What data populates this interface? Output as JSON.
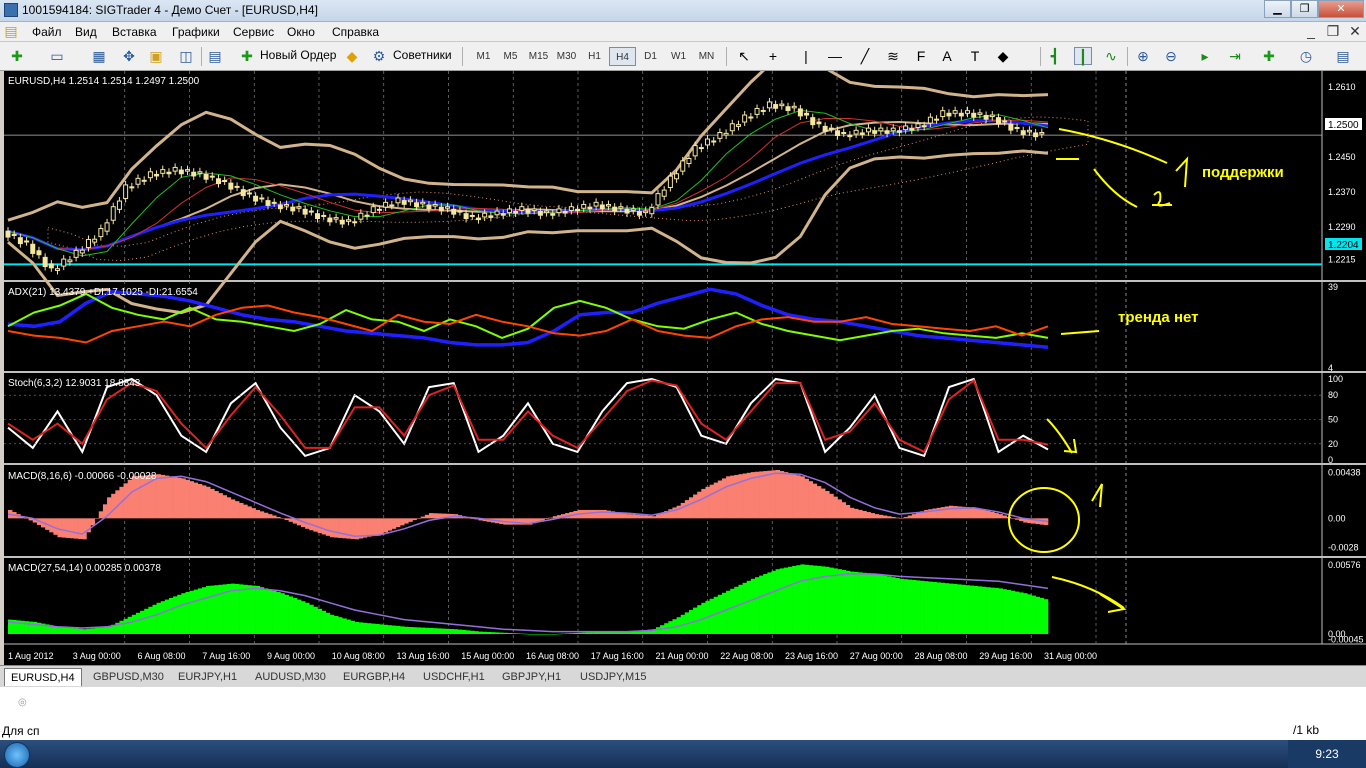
{
  "window": {
    "title": "1001594184: SIGTrader 4 - Демо Счет - [EURUSD,H4]"
  },
  "menu": [
    "Файл",
    "Вид",
    "Вставка",
    "Графики",
    "Сервис",
    "Окно",
    "Справка"
  ],
  "toolbar": {
    "new_order": "Новый Ордер",
    "advisors": "Советники",
    "timeframes": [
      "M1",
      "M5",
      "M15",
      "M30",
      "H1",
      "H4",
      "D1",
      "W1",
      "MN"
    ],
    "active_timeframe": "H4"
  },
  "chart_data": [
    {
      "type": "candlestick",
      "title": "EURUSD,H4  1.2514 1.2514 1.2497 1.2500",
      "yticks": [
        "1.2610",
        "1.2530",
        "1.2450",
        "1.2370",
        "1.2290",
        "1.2215"
      ],
      "ylim": [
        1.2175,
        1.264
      ],
      "current_price_label": "1.2500",
      "horizontal_level_label": "1.2204",
      "horizontal_level": 1.2204,
      "close_series": [
        1.228,
        1.225,
        1.219,
        1.223,
        1.228,
        1.238,
        1.241,
        1.242,
        1.241,
        1.239,
        1.236,
        1.234,
        1.233,
        1.231,
        1.23,
        1.233,
        1.235,
        1.234,
        1.233,
        1.231,
        1.232,
        1.233,
        1.232,
        1.233,
        1.234,
        1.233,
        1.232,
        1.24,
        1.247,
        1.25,
        1.254,
        1.257,
        1.256,
        1.252,
        1.25,
        1.251,
        1.251,
        1.252,
        1.255,
        1.255,
        1.254,
        1.251,
        1.25
      ],
      "annotations": [
        "поддержки"
      ],
      "colors": {
        "bollinger": "#d2b48c",
        "ma_blue": "#2020ff",
        "cyan_level": "#00e5ee",
        "annotation": "#ffff00"
      }
    },
    {
      "type": "line",
      "title": "ADX(21) 13.4379 +DI:17.1025 -DI:21.6554",
      "yticks": [
        "39",
        "4"
      ],
      "ylim": [
        4,
        39
      ],
      "series": [
        {
          "name": "ADX",
          "values": [
            23,
            22,
            24,
            32,
            37,
            36,
            35,
            33,
            30,
            27,
            25,
            24,
            22,
            20,
            19,
            18,
            17,
            15,
            14,
            14,
            15,
            20,
            27,
            28,
            28,
            32,
            35,
            38,
            36,
            31,
            27,
            25,
            24,
            22,
            20,
            18,
            17,
            16,
            15,
            14,
            13
          ]
        },
        {
          "name": "+DI",
          "values": [
            22,
            28,
            31,
            36,
            30,
            27,
            25,
            30,
            25,
            24,
            22,
            20,
            23,
            29,
            25,
            24,
            20,
            25,
            22,
            17,
            21,
            30,
            33,
            30,
            25,
            22,
            21,
            25,
            28,
            23,
            20,
            18,
            16,
            18,
            20,
            21,
            19,
            18,
            17,
            19,
            17
          ]
        },
        {
          "name": "-DI",
          "values": [
            20,
            18,
            17,
            15,
            20,
            22,
            24,
            22,
            27,
            30,
            31,
            28,
            26,
            23,
            20,
            27,
            24,
            23,
            27,
            24,
            22,
            19,
            18,
            20,
            25,
            20,
            18,
            17,
            22,
            25,
            26,
            24,
            24,
            26,
            23,
            22,
            21,
            20,
            22,
            18,
            22
          ]
        }
      ],
      "annotations": [
        "тренда нет"
      ],
      "colors": {
        "adx": "#2020ff",
        "plus_di": "#7fff00",
        "minus_di": "#ff4500"
      }
    },
    {
      "type": "line",
      "title": "Stoch(6,3,2) 12.9031 18.8843",
      "yticks": [
        "100",
        "80",
        "50",
        "20",
        "0"
      ],
      "ylim": [
        0,
        100
      ],
      "series": [
        {
          "name": "main",
          "values": [
            40,
            15,
            60,
            10,
            90,
            100,
            80,
            30,
            10,
            70,
            95,
            40,
            5,
            15,
            80,
            60,
            20,
            90,
            95,
            10,
            30,
            70,
            20,
            10,
            60,
            95,
            100,
            90,
            30,
            20,
            70,
            100,
            95,
            10,
            40,
            80,
            15,
            5,
            90,
            100,
            10,
            30,
            13
          ]
        },
        {
          "name": "signal",
          "values": [
            45,
            25,
            45,
            20,
            75,
            95,
            85,
            45,
            15,
            55,
            90,
            55,
            15,
            15,
            65,
            65,
            30,
            80,
            92,
            25,
            25,
            60,
            30,
            15,
            50,
            85,
            98,
            92,
            45,
            25,
            60,
            95,
            95,
            25,
            35,
            70,
            25,
            10,
            75,
            98,
            25,
            25,
            19
          ]
        }
      ],
      "colors": {
        "main": "#ffffff",
        "signal": "#dd2222"
      }
    },
    {
      "type": "bar",
      "title": "MACD(8,16,6) -0.00066 -0.00028",
      "yticks": [
        "0.00438",
        "0.00",
        "-0.0028"
      ],
      "ylim": [
        -0.0033,
        0.0046
      ],
      "values": [
        0.0008,
        -0.0004,
        -0.0018,
        -0.002,
        0.002,
        0.004,
        0.0042,
        0.0038,
        0.003,
        0.0018,
        0.0008,
        0.0,
        -0.001,
        -0.0018,
        -0.002,
        -0.0015,
        -0.0005,
        0.0005,
        0.0004,
        -0.0002,
        -0.0006,
        -0.0006,
        0.0002,
        0.0008,
        0.0008,
        0.0004,
        0.0002,
        0.0012,
        0.0028,
        0.004,
        0.0044,
        0.0046,
        0.004,
        0.0026,
        0.001,
        0.0004,
        0.0,
        0.0008,
        0.0012,
        0.001,
        0.0004,
        -0.0004,
        -0.0007
      ],
      "signal": [
        0.0004,
        0.0,
        -0.001,
        -0.0015,
        0.0002,
        0.0025,
        0.0038,
        0.004,
        0.0035,
        0.0025,
        0.0015,
        0.0005,
        -0.0004,
        -0.0012,
        -0.0017,
        -0.0016,
        -0.001,
        -0.0002,
        0.0002,
        0.0,
        -0.0003,
        -0.0005,
        -0.0001,
        0.0004,
        0.0006,
        0.0005,
        0.0003,
        0.0008,
        0.0018,
        0.003,
        0.0038,
        0.0043,
        0.0042,
        0.0034,
        0.002,
        0.001,
        0.0004,
        0.0006,
        0.0009,
        0.001,
        0.0006,
        0.0,
        -0.0003
      ],
      "colors": {
        "histogram": "#fa8072",
        "signal": "#9370db"
      }
    },
    {
      "type": "bar",
      "title": "MACD(27,54,14) 0.00285 0.00378",
      "yticks": [
        "0.00576",
        "0.00",
        "-0.00045"
      ],
      "ylim": [
        -0.0005,
        0.006
      ],
      "values": [
        0.0012,
        0.001,
        0.0006,
        0.0004,
        0.0006,
        0.0016,
        0.0026,
        0.0034,
        0.004,
        0.0042,
        0.004,
        0.0034,
        0.0026,
        0.0016,
        0.001,
        0.0008,
        0.0006,
        0.0005,
        0.0004,
        0.0002,
        0.0001,
        0.0,
        0.0,
        0.0001,
        0.0002,
        0.0002,
        0.0004,
        0.0014,
        0.0026,
        0.0036,
        0.0046,
        0.0054,
        0.0058,
        0.0056,
        0.0052,
        0.005,
        0.0046,
        0.0044,
        0.0042,
        0.004,
        0.0038,
        0.0034,
        0.0028
      ],
      "signal": [
        0.001,
        0.0008,
        0.0006,
        0.0005,
        0.0006,
        0.001,
        0.0016,
        0.0024,
        0.003,
        0.0036,
        0.0038,
        0.0036,
        0.0032,
        0.0026,
        0.002,
        0.0016,
        0.0012,
        0.001,
        0.0008,
        0.0006,
        0.0004,
        0.0003,
        0.0002,
        0.0002,
        0.0002,
        0.0002,
        0.0003,
        0.0006,
        0.0012,
        0.002,
        0.0028,
        0.0036,
        0.0044,
        0.0048,
        0.005,
        0.005,
        0.0048,
        0.0047,
        0.0046,
        0.0045,
        0.0044,
        0.0041,
        0.0038
      ],
      "colors": {
        "histogram": "#00ff00",
        "signal": "#9370db"
      }
    }
  ],
  "xaxis": [
    "1 Aug 2012",
    "3 Aug 00:00",
    "6 Aug 08:00",
    "7 Aug 16:00",
    "9 Aug 00:00",
    "10 Aug 08:00",
    "13 Aug 16:00",
    "15 Aug 00:00",
    "16 Aug 08:00",
    "17 Aug 16:00",
    "21 Aug 00:00",
    "22 Aug 08:00",
    "23 Aug 16:00",
    "27 Aug 00:00",
    "28 Aug 08:00",
    "29 Aug 16:00",
    "31 Aug 00:00"
  ],
  "tabs": [
    "EURUSD,H4",
    "GBPUSD,M30",
    "EURJPY,H1",
    "AUDUSD,M30",
    "EURGBP,H4",
    "USDCHF,H1",
    "GBPJPY,H1",
    "USDJPY,M15"
  ],
  "active_tab": "EURUSD,H4",
  "status": {
    "left": "Для сп",
    "right": "/1 kb"
  },
  "tray": {
    "time": "9:23"
  }
}
